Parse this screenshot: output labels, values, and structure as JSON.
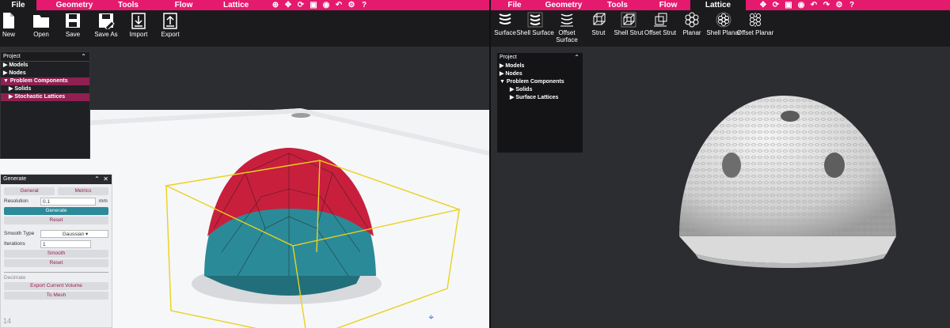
{
  "left": {
    "menubar": {
      "items": [
        "File",
        "Geometry",
        "Tools",
        "Flow",
        "Lattice"
      ],
      "icons": [
        "globe-icon",
        "move-icon",
        "refresh-icon",
        "frame-icon",
        "eye-icon",
        "undo-icon",
        "gear-icon",
        "help-icon"
      ],
      "icon_glyphs": [
        "⊕",
        "✥",
        "⟳",
        "▣",
        "◉",
        "↶",
        "⚙",
        "?"
      ]
    },
    "toolbar": [
      {
        "label": "New",
        "icon": "new-file-icon"
      },
      {
        "label": "Open",
        "icon": "folder-icon"
      },
      {
        "label": "Save",
        "icon": "save-icon"
      },
      {
        "label": "Save As",
        "icon": "save-as-icon"
      },
      {
        "label": "Import",
        "icon": "import-icon"
      },
      {
        "label": "Export",
        "icon": "export-icon"
      }
    ],
    "project": {
      "title": "Project",
      "nodes": [
        "Models",
        "Nodes",
        "Problem Components",
        "Solids",
        "Stochastic Lattices"
      ]
    },
    "generate": {
      "title": "Generate",
      "tabs": [
        "General",
        "Metrics"
      ],
      "resolution_label": "Resolution",
      "resolution_value": "0.1",
      "resolution_unit": "mm",
      "generate_btn": "Generate",
      "reset_btn": "Reset",
      "smooth_type_label": "Smooth Type",
      "smooth_type_value": "Gaussian",
      "iterations_label": "Iterations",
      "iterations_value": "1",
      "smooth_btn": "Smooth",
      "reset2_btn": "Reset",
      "decimate_label": "Decimate",
      "export_btn": "Export Current Volume",
      "mesh_btn": "To Mesh"
    },
    "corner_text": "14"
  },
  "right": {
    "menubar": {
      "items": [
        "File",
        "Geometry",
        "Tools",
        "Flow",
        "Lattice"
      ],
      "icons": [
        "move-icon",
        "refresh-icon",
        "frame-icon",
        "eye-icon",
        "undo-icon",
        "redo-icon",
        "gear-icon",
        "help-icon"
      ],
      "icon_glyphs": [
        "✥",
        "⟳",
        "▣",
        "◉",
        "↶",
        "↷",
        "⚙",
        "?"
      ]
    },
    "toolbar": [
      {
        "label": "Surface",
        "icon": "surface-icon"
      },
      {
        "label": "Shell Surface",
        "icon": "shell-surface-icon"
      },
      {
        "label": "Offset Surface",
        "icon": "offset-surface-icon"
      },
      {
        "label": "Strut",
        "icon": "strut-icon"
      },
      {
        "label": "Shell Strut",
        "icon": "shell-strut-icon"
      },
      {
        "label": "Offset Strut",
        "icon": "offset-strut-icon"
      },
      {
        "label": "Planar",
        "icon": "planar-icon"
      },
      {
        "label": "Shell Planar",
        "icon": "shell-planar-icon"
      },
      {
        "label": "Offset Planar",
        "icon": "offset-planar-icon"
      }
    ],
    "project": {
      "title": "Project",
      "nodes": [
        "Models",
        "Nodes",
        "Problem Components",
        "Solids",
        "Surface Lattices"
      ]
    }
  },
  "colors": {
    "accent": "#e5196e",
    "panel_dark": "#1b1b1d",
    "lattice_red": "#d4203e",
    "lattice_teal": "#2b8a98",
    "bbox_yellow": "#e8d21c"
  }
}
